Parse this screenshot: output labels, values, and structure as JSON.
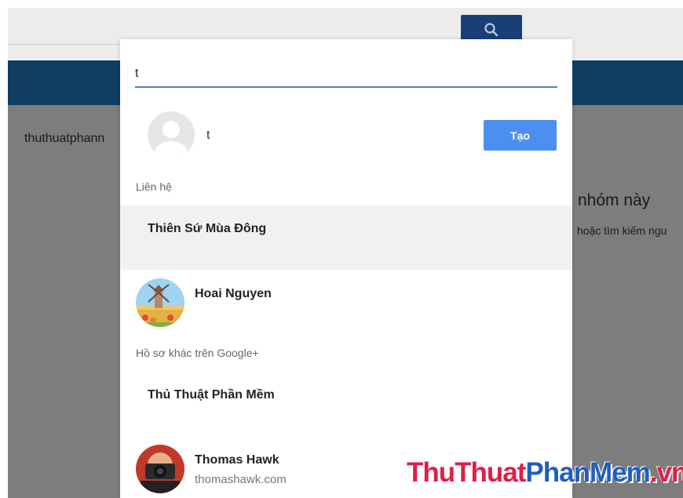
{
  "background": {
    "sidebar_text": "thuthuatphann",
    "empty_title": "nhóm này",
    "empty_hint": "hoặc tìm kiếm ngu"
  },
  "dialog": {
    "search_value": "t",
    "create_name": "t",
    "create_label": "Tạo",
    "contacts_section": "Liên hệ",
    "contacts": [
      {
        "name": "Thiên Sứ Mùa Đông"
      },
      {
        "name": "Hoai Nguyen"
      }
    ],
    "other_section": "Hồ sơ khác trên Google+",
    "others": [
      {
        "name": "Thủ Thuật Phần Mềm"
      },
      {
        "name": "Thomas Hawk",
        "subtitle": "thomashawk.com"
      }
    ]
  },
  "watermark": {
    "part1": "ThuThuat",
    "part2": "PhanMem",
    "part3": ".vn"
  },
  "colors": {
    "accent": "#4d8ff0",
    "input_underline": "#4c80c5",
    "nav": "#0e3f63",
    "search_button": "#1a3e78",
    "overlay": "#7d7d7d"
  },
  "icons": [
    "search-icon",
    "default-avatar-icon",
    "hoai-nguyen-avatar",
    "thomas-hawk-avatar"
  ]
}
